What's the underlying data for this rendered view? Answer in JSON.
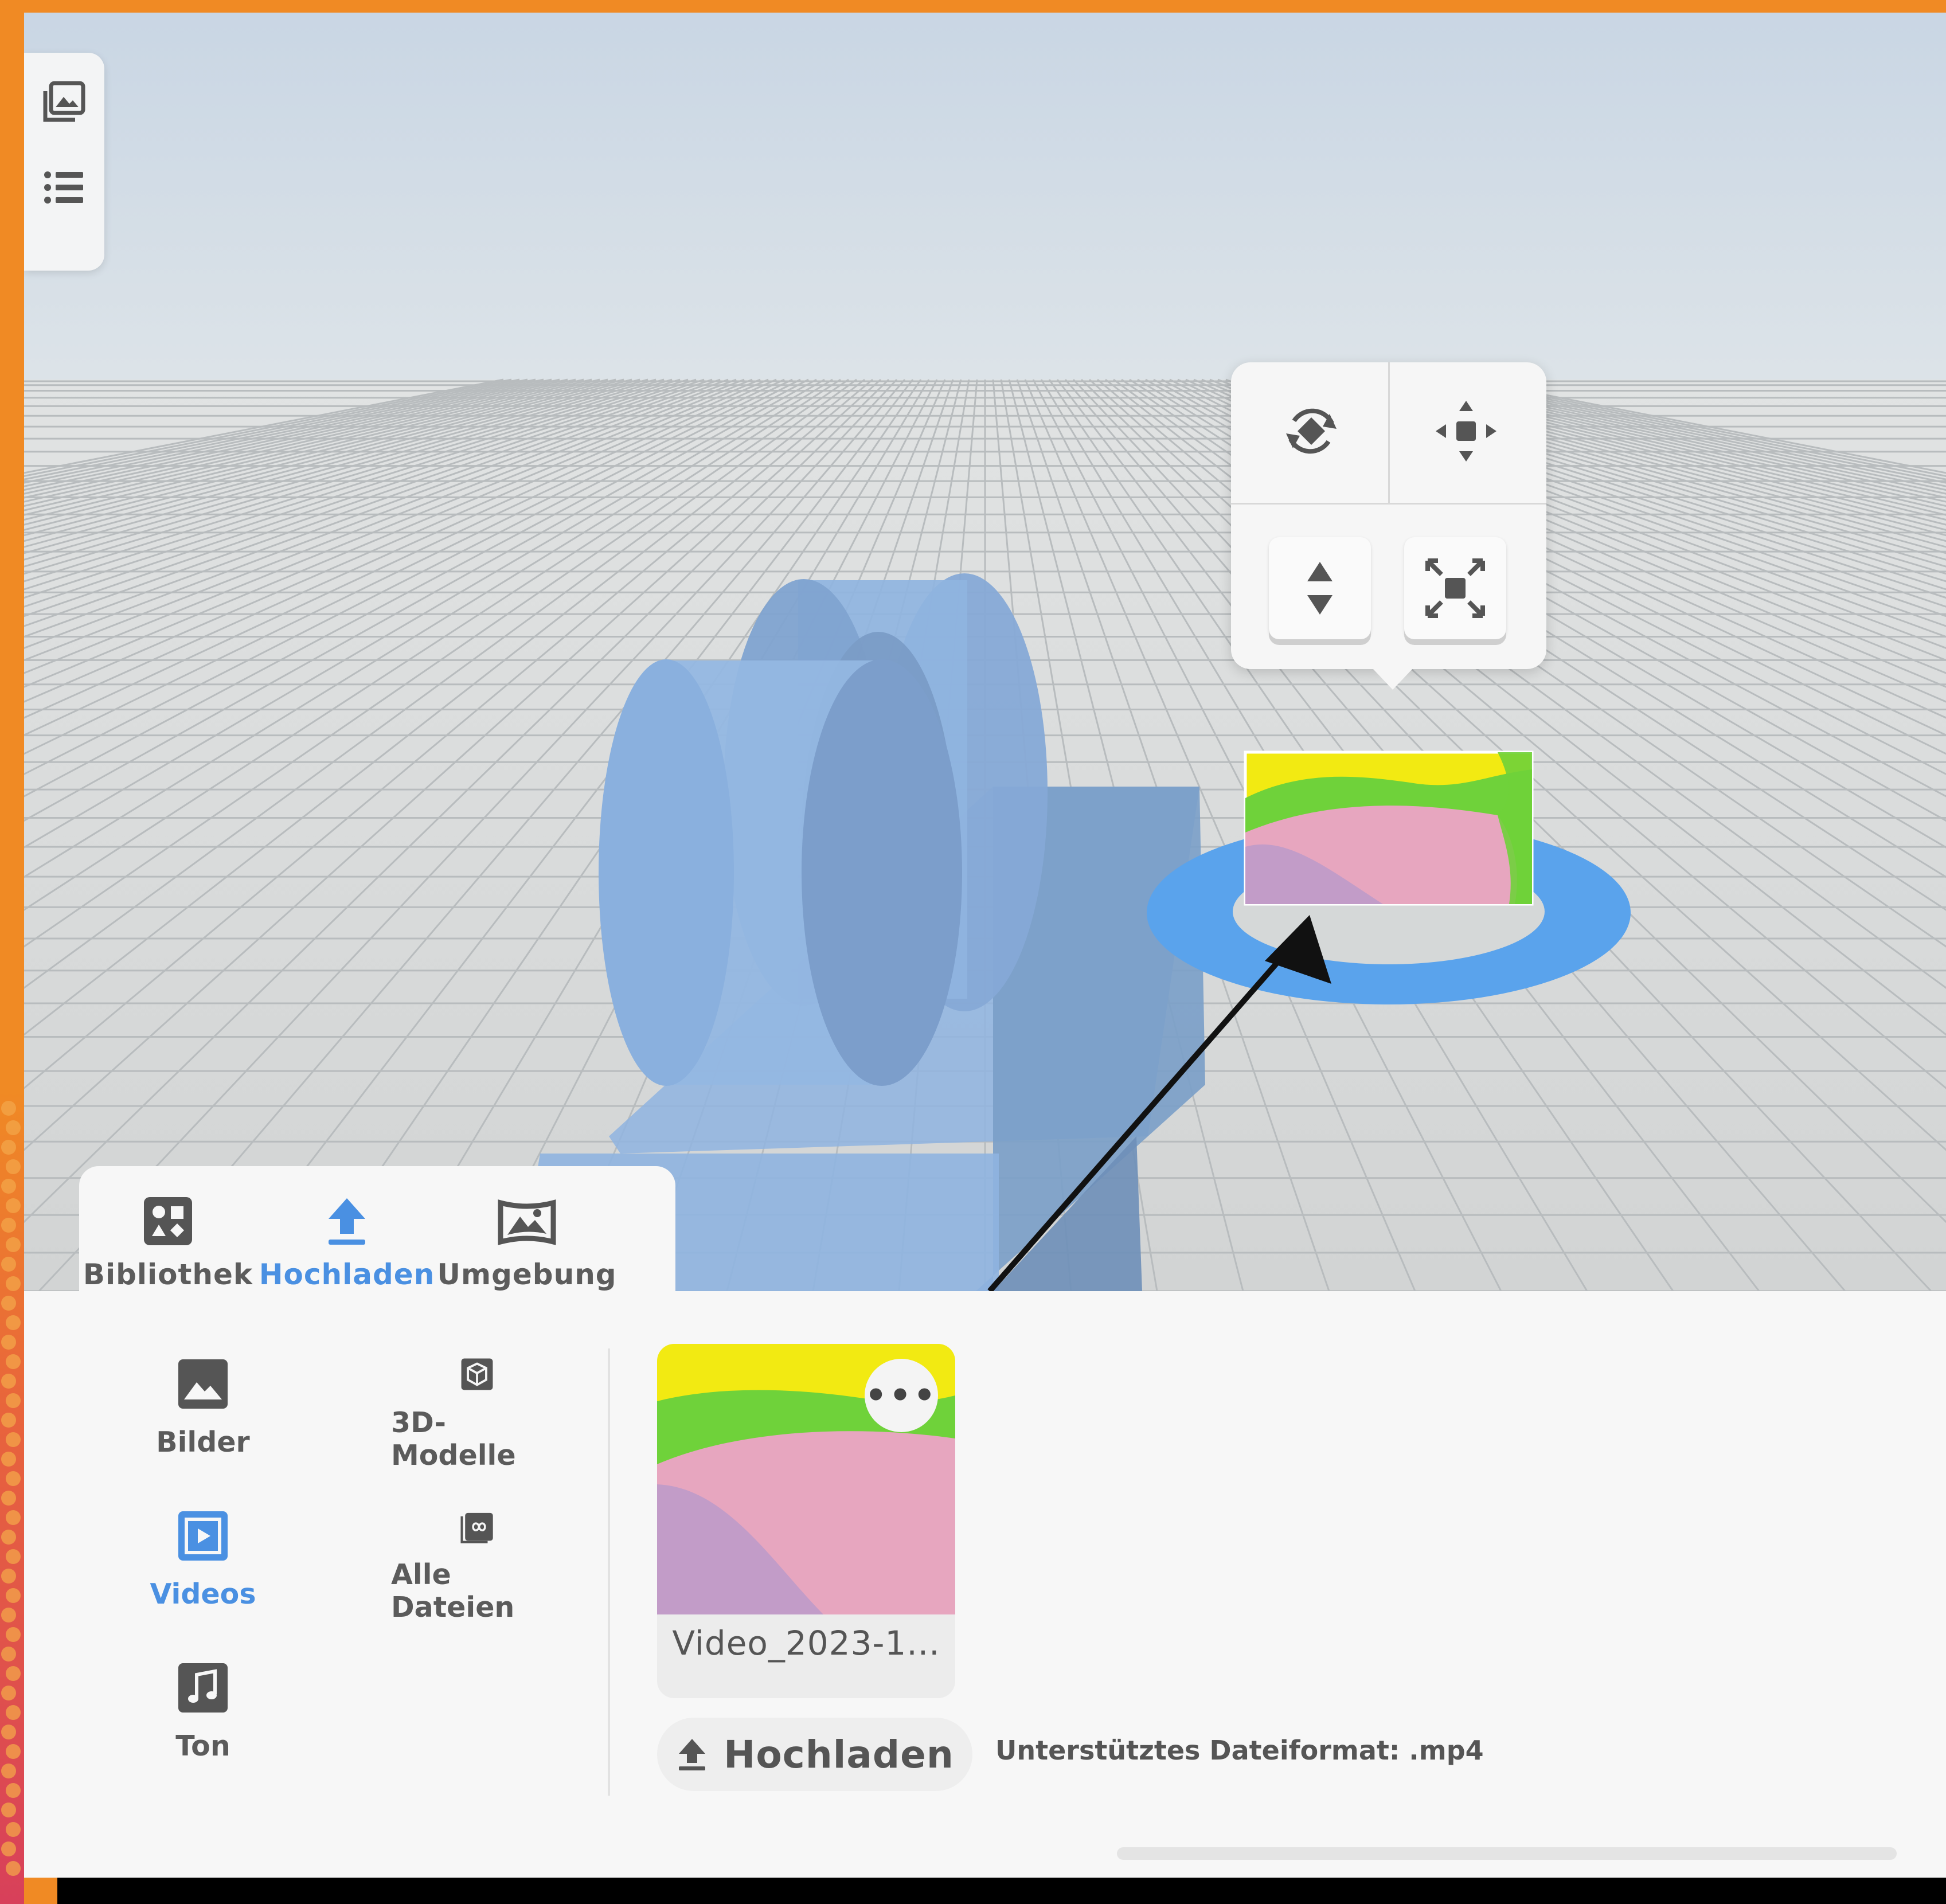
{
  "tabs": [
    {
      "label": "Bibliothek",
      "icon": "library-icon"
    },
    {
      "label": "Hochladen",
      "icon": "upload-icon",
      "active": true
    },
    {
      "label": "Umgebung",
      "icon": "environment-icon"
    }
  ],
  "categories": [
    {
      "label": "Bilder",
      "icon": "image-icon"
    },
    {
      "label": "3D-Modelle",
      "icon": "cube-icon"
    },
    {
      "label": "Videos",
      "icon": "video-icon",
      "active": true
    },
    {
      "label": "Alle Dateien",
      "icon": "all-files-icon"
    },
    {
      "label": "Ton",
      "icon": "music-note-icon"
    }
  ],
  "file": {
    "name": "Video_2023-1...",
    "more_label": "•••"
  },
  "upload": {
    "label": "Hochladen",
    "note": "Unterstütztes Dateiformat: .mp4"
  },
  "gizmo": {
    "tools": [
      "rotate-icon",
      "move-icon",
      "lift-icon",
      "scale-icon"
    ]
  },
  "left_tools": [
    "gallery-icon",
    "list-icon"
  ],
  "colors": {
    "accent": "#4a90e2",
    "frame": "#f08a24",
    "model": "#8fb4e0",
    "selection_ring": "#5aa3ec",
    "video_yellow": "#f2ea12",
    "video_green": "#6fd23a",
    "video_pink": "#e7a6bf",
    "video_purple": "#c29cc8"
  }
}
